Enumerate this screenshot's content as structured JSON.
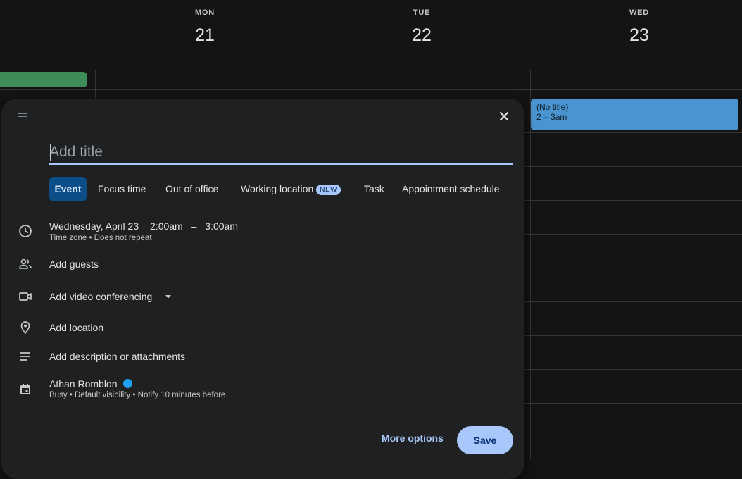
{
  "calendar": {
    "days": [
      {
        "dow": "MON",
        "num": "21"
      },
      {
        "dow": "TUE",
        "num": "22"
      },
      {
        "dow": "WED",
        "num": "23"
      }
    ],
    "event": {
      "title": "(No title)",
      "time": "2 – 3am",
      "color": "#4a95d1"
    },
    "allday_event_color": "#3f8c5b"
  },
  "dialog": {
    "title_placeholder": "Add title",
    "tabs": [
      {
        "label": "Event",
        "active": true
      },
      {
        "label": "Focus time"
      },
      {
        "label": "Out of office"
      },
      {
        "label": "Working location",
        "badge": "NEW"
      },
      {
        "label": "Task"
      },
      {
        "label": "Appointment schedule"
      }
    ],
    "datetime": {
      "date": "Wednesday, April 23",
      "start": "2:00am",
      "separator": "–",
      "end": "3:00am",
      "sub": "Time zone • Does not repeat"
    },
    "guests": "Add guests",
    "video": "Add video conferencing",
    "location": "Add location",
    "description": "Add description or attachments",
    "calendar_owner": {
      "name": "Athan Romblon",
      "dot_color": "#1ea1f2",
      "sub": "Busy • Default visibility • Notify 10 minutes before"
    },
    "more_options": "More options",
    "save": "Save"
  },
  "icons": [
    "drag-handle-icon",
    "close-icon",
    "clock-icon",
    "people-icon",
    "video-icon",
    "chevron-down-icon",
    "location-pin-icon",
    "notes-icon",
    "calendar-icon"
  ]
}
